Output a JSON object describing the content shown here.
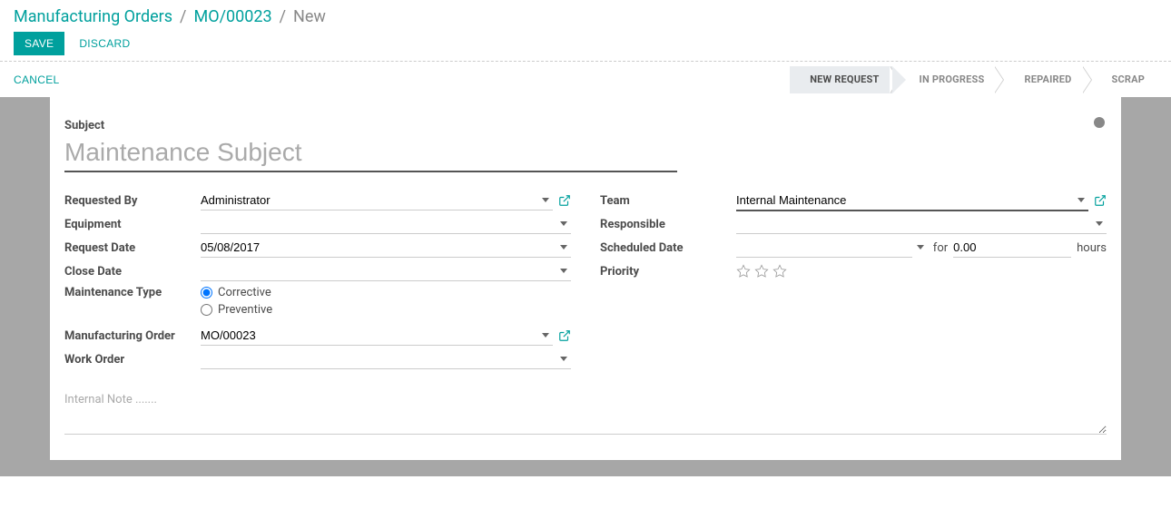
{
  "breadcrumb": {
    "root": "Manufacturing Orders",
    "parent": "MO/00023",
    "current": "New"
  },
  "buttons": {
    "save": "SAVE",
    "discard": "DISCARD",
    "cancel": "CANCEL"
  },
  "stages": {
    "new_request": "NEW REQUEST",
    "in_progress": "IN PROGRESS",
    "repaired": "REPAIRED",
    "scrap": "SCRAP"
  },
  "subject": {
    "label": "Subject",
    "placeholder": "Maintenance Subject",
    "value": ""
  },
  "left": {
    "requested_by": {
      "label": "Requested By",
      "value": "Administrator"
    },
    "equipment": {
      "label": "Equipment",
      "value": ""
    },
    "request_date": {
      "label": "Request Date",
      "value": "05/08/2017"
    },
    "close_date": {
      "label": "Close Date",
      "value": ""
    },
    "maintenance_type": {
      "label": "Maintenance Type",
      "corrective": "Corrective",
      "preventive": "Preventive",
      "selected": "corrective"
    },
    "manufacturing_order": {
      "label": "Manufacturing Order",
      "value": "MO/00023"
    },
    "work_order": {
      "label": "Work Order",
      "value": ""
    }
  },
  "right": {
    "team": {
      "label": "Team",
      "value": "Internal Maintenance"
    },
    "responsible": {
      "label": "Responsible",
      "value": ""
    },
    "scheduled_date": {
      "label": "Scheduled Date",
      "date": "",
      "for": "for",
      "duration": "0.00",
      "unit": "hours"
    },
    "priority": {
      "label": "Priority"
    }
  },
  "note": {
    "placeholder": "Internal Note .......",
    "value": ""
  }
}
